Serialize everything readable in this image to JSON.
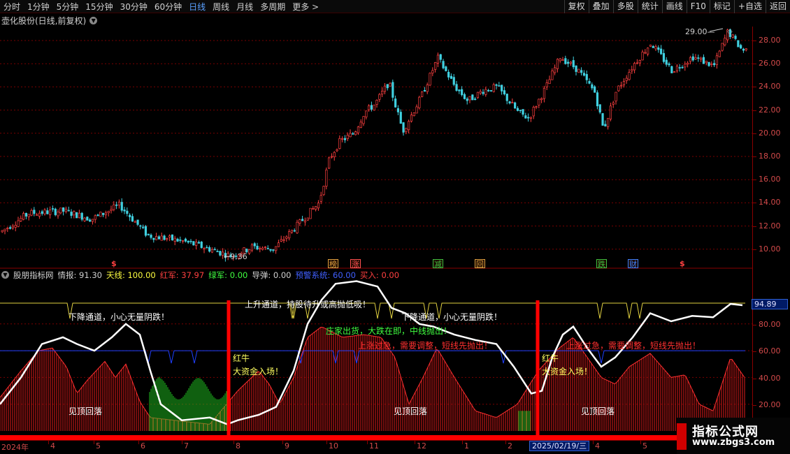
{
  "toolbar": {
    "periods": [
      "分时",
      "1分钟",
      "5分钟",
      "15分钟",
      "30分钟",
      "60分钟",
      "日线",
      "周线",
      "月线",
      "多周期",
      "更多 >"
    ],
    "active_period": "日线",
    "right_buttons": [
      "复权",
      "叠加",
      "多股",
      "统计",
      "画线",
      "F10",
      "标记",
      "+自选",
      "返回"
    ]
  },
  "stock": {
    "title": "壶化股份(日线,前复权)"
  },
  "main_chart": {
    "price_axis": [
      "28.00",
      "26.00",
      "24.00",
      "22.00",
      "20.00",
      "18.00",
      "16.00",
      "14.00",
      "12.00",
      "10.00"
    ],
    "high_label": "29.00",
    "low_label": "9.36",
    "markers": [
      {
        "text": "榜",
        "color": "#e0a040"
      },
      {
        "text": "涨",
        "color": "#ff5050"
      },
      {
        "text": "减",
        "color": "#40c040"
      },
      {
        "text": "回",
        "color": "#e0a040"
      },
      {
        "text": "跌",
        "color": "#40c040"
      },
      {
        "text": "财",
        "color": "#4080ff"
      },
      {
        "text": "$",
        "color": "#ff4040"
      },
      {
        "text": "$",
        "color": "#ff4040"
      }
    ]
  },
  "indicator": {
    "name": "股朋指标网",
    "fields": [
      {
        "label": "情报:",
        "value": "91.30",
        "color": "#d0d0d0"
      },
      {
        "label": "天线:",
        "value": "100.00",
        "color": "#ffff40"
      },
      {
        "label": "红军:",
        "value": "37.97",
        "color": "#ff4040"
      },
      {
        "label": "绿军:",
        "value": "0.00",
        "color": "#40ff40"
      },
      {
        "label": "导弹:",
        "value": "0.00",
        "color": "#d0d0d0"
      },
      {
        "label": "预警系统:",
        "value": "60.00",
        "color": "#4060ff"
      },
      {
        "label": "买入:",
        "value": "0.00",
        "color": "#ff4040"
      }
    ],
    "axis": [
      "94.89",
      "80.00",
      "60.00",
      "40.00",
      "20.00"
    ],
    "current_value": "94.89"
  },
  "annotations": {
    "down_channel_1": "下降通道，小心无量阴跌！",
    "up_channel": "上升通道，持股待升或高抛低吸！",
    "down_channel_2": "下降通道，小心无量阴跌！",
    "dealer_out": "庄家出货，大跌在即，中线抛出！",
    "rise_fast_1": "上涨过急，需要调整，短线先抛出！",
    "rise_fast_2": "上涨过急，需要调整，短线先抛出！",
    "red_bull_1": "红牛",
    "capital_in_1": "大资金入场！",
    "red_bull_2": "红牛",
    "capital_in_2": "大资金入场！",
    "peak_fall_1": "见顶回落",
    "peak_fall_2": "见顶回落",
    "peak_fall_3": "见顶回落"
  },
  "date_axis": {
    "labels": [
      "2024年",
      "4",
      "5",
      "6",
      "7",
      "8",
      "9",
      "10",
      "11",
      "12",
      "1",
      "2",
      "4",
      "5"
    ],
    "current_date": "2025/02/19/三"
  },
  "watermark": {
    "title": "指标公式网",
    "url": "www.zbgs3.com"
  },
  "colors": {
    "up": "#ff4040",
    "down": "#40d0e0",
    "grid": "#8a0000",
    "white_line": "#ffffff",
    "yellow_line": "#ffff40",
    "blue_line": "#2040ff"
  }
}
